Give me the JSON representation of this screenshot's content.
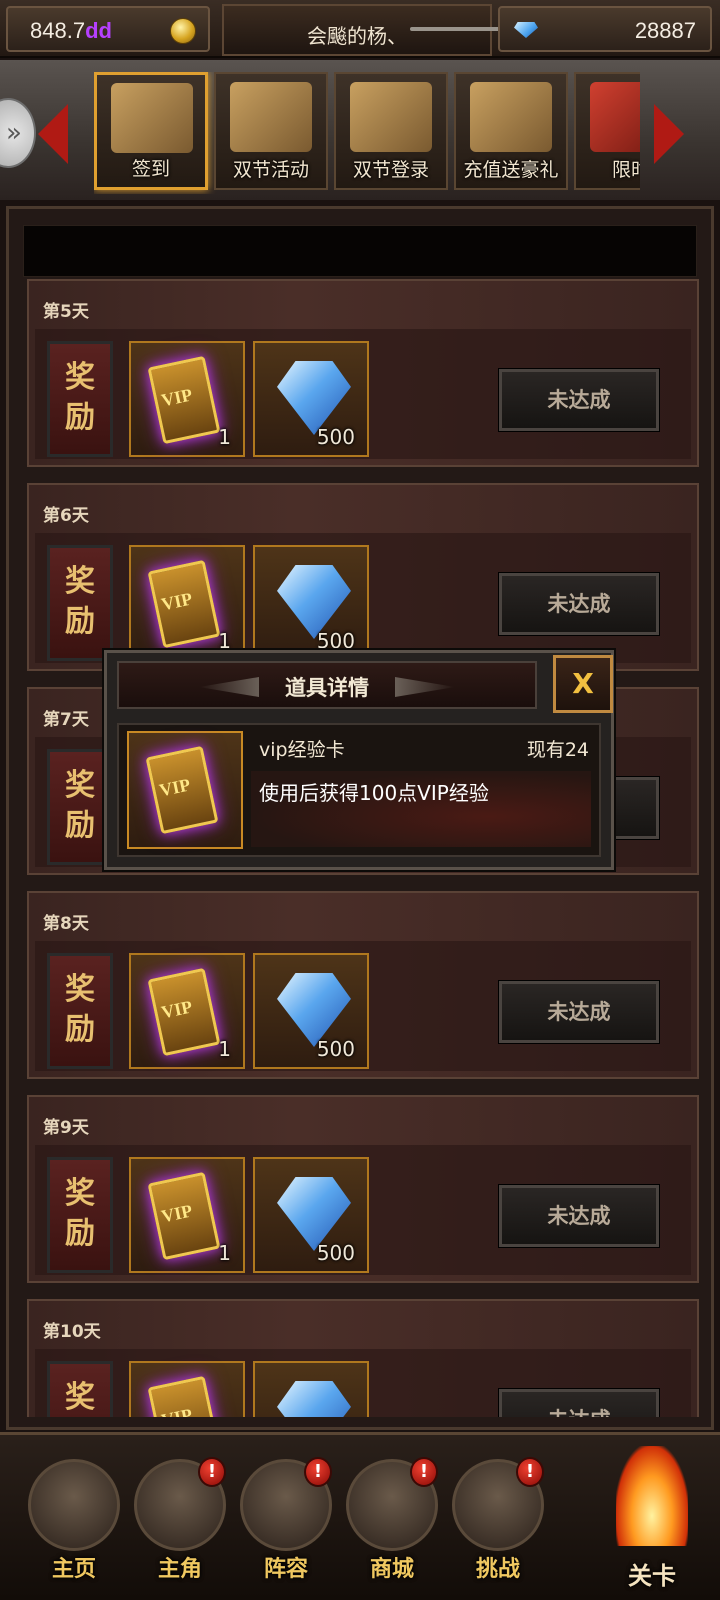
{
  "topbar": {
    "gold_amount": "848.7",
    "gold_unit": "dd",
    "player_name": "会飈的杨、",
    "gems": "28887"
  },
  "tabs": [
    {
      "label": "签到",
      "active": true
    },
    {
      "label": "双节活动",
      "active": false
    },
    {
      "label": "双节登录",
      "active": false
    },
    {
      "label": "充值送豪礼",
      "active": false
    },
    {
      "label": "限时",
      "active": false
    }
  ],
  "reward_tag": [
    "奖",
    "励"
  ],
  "rows": [
    {
      "day": "第5天",
      "vip_count": "1",
      "diamond_count": "500",
      "status": "未达成"
    },
    {
      "day": "第6天",
      "vip_count": "1",
      "diamond_count": "500",
      "status": "未达成"
    },
    {
      "day": "第7天",
      "vip_count": "",
      "diamond_count": "",
      "status": ""
    },
    {
      "day": "第8天",
      "vip_count": "1",
      "diamond_count": "500",
      "status": "未达成"
    },
    {
      "day": "第9天",
      "vip_count": "1",
      "diamond_count": "500",
      "status": "未达成"
    },
    {
      "day": "第10天",
      "vip_count": "",
      "diamond_count": "",
      "status": "未达成"
    }
  ],
  "popup": {
    "title": "道具详情",
    "close_label": "X",
    "item_name": "vip经验卡",
    "owned": "现有24",
    "description": "使用后获得100点VIP经验"
  },
  "nav": [
    {
      "label": "主页",
      "badge": ""
    },
    {
      "label": "主角",
      "badge": "!"
    },
    {
      "label": "阵容",
      "badge": "!"
    },
    {
      "label": "商城",
      "badge": "!"
    },
    {
      "label": "挑战",
      "badge": "!"
    },
    {
      "label": "关卡",
      "badge": ""
    }
  ],
  "colors": {
    "accent_gold": "#e0a030",
    "alert_red": "#d02010",
    "gold_unit_purple": "#b640ff"
  }
}
